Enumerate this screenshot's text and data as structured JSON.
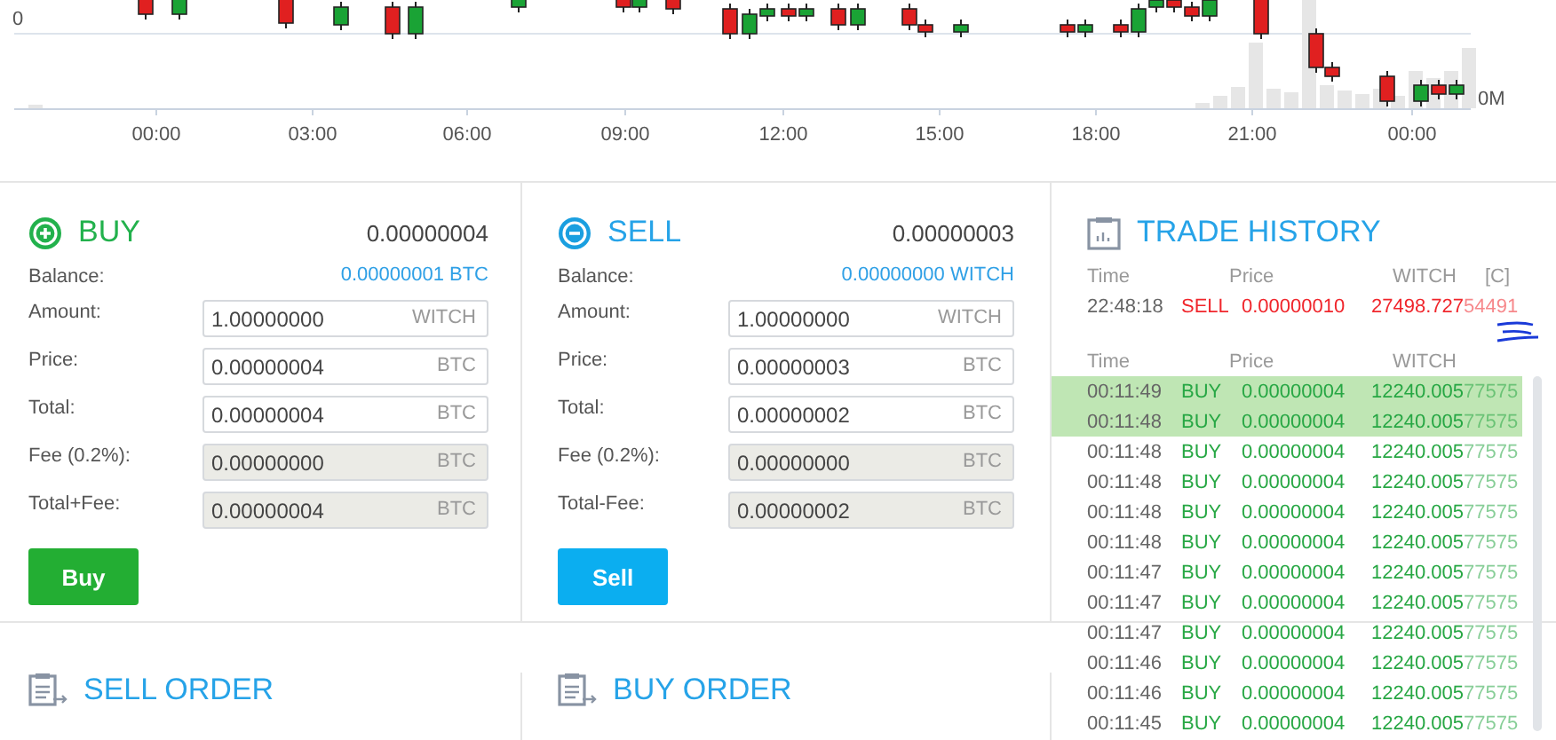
{
  "chart": {
    "y_label": "0",
    "volume_label": "0M",
    "x_ticks": [
      "00:00",
      "03:00",
      "06:00",
      "09:00",
      "12:00",
      "15:00",
      "18:00",
      "21:00",
      "00:00"
    ]
  },
  "buy": {
    "title": "BUY",
    "price": "0.00000004",
    "balance_label": "Balance:",
    "balance": "0.00000001 BTC",
    "fields": [
      {
        "label": "Amount:",
        "value": "1.00000000",
        "unit": "WITCH",
        "disabled": false
      },
      {
        "label": "Price:",
        "value": "0.00000004",
        "unit": "BTC",
        "disabled": false
      },
      {
        "label": "Total:",
        "value": "0.00000004",
        "unit": "BTC",
        "disabled": false
      },
      {
        "label": "Fee (0.2%):",
        "value": "0.00000000",
        "unit": "BTC",
        "disabled": true
      },
      {
        "label": "Total+Fee:",
        "value": "0.00000004",
        "unit": "BTC",
        "disabled": true
      }
    ],
    "button": "Buy"
  },
  "sell": {
    "title": "SELL",
    "price": "0.00000003",
    "balance_label": "Balance:",
    "balance": "0.00000000 WITCH",
    "fields": [
      {
        "label": "Amount:",
        "value": "1.00000000",
        "unit": "WITCH",
        "disabled": false
      },
      {
        "label": "Price:",
        "value": "0.00000003",
        "unit": "BTC",
        "disabled": false
      },
      {
        "label": "Total:",
        "value": "0.00000002",
        "unit": "BTC",
        "disabled": false
      },
      {
        "label": "Fee (0.2%):",
        "value": "0.00000000",
        "unit": "BTC",
        "disabled": true
      },
      {
        "label": "Total-Fee:",
        "value": "0.00000002",
        "unit": "BTC",
        "disabled": true
      }
    ],
    "button": "Sell"
  },
  "trade_history": {
    "title": "TRADE HISTORY",
    "my_columns": [
      "Time",
      "Price",
      "WITCH",
      "[C]"
    ],
    "my_trades": [
      {
        "time": "22:48:18",
        "side": "SELL",
        "price": "0.00000010",
        "amount": "27498.727",
        "amount_tail": "54491"
      }
    ],
    "columns": [
      "Time",
      "Price",
      "WITCH"
    ],
    "trades": [
      {
        "time": "00:11:49",
        "side": "BUY",
        "price": "0.00000004",
        "amount": "12240.005",
        "amount_tail": "77575",
        "highlighted": true
      },
      {
        "time": "00:11:48",
        "side": "BUY",
        "price": "0.00000004",
        "amount": "12240.005",
        "amount_tail": "77575",
        "highlighted": true
      },
      {
        "time": "00:11:48",
        "side": "BUY",
        "price": "0.00000004",
        "amount": "12240.005",
        "amount_tail": "77575",
        "highlighted": false
      },
      {
        "time": "00:11:48",
        "side": "BUY",
        "price": "0.00000004",
        "amount": "12240.005",
        "amount_tail": "77575",
        "highlighted": false
      },
      {
        "time": "00:11:48",
        "side": "BUY",
        "price": "0.00000004",
        "amount": "12240.005",
        "amount_tail": "77575",
        "highlighted": false
      },
      {
        "time": "00:11:48",
        "side": "BUY",
        "price": "0.00000004",
        "amount": "12240.005",
        "amount_tail": "77575",
        "highlighted": false
      },
      {
        "time": "00:11:47",
        "side": "BUY",
        "price": "0.00000004",
        "amount": "12240.005",
        "amount_tail": "77575",
        "highlighted": false
      },
      {
        "time": "00:11:47",
        "side": "BUY",
        "price": "0.00000004",
        "amount": "12240.005",
        "amount_tail": "77575",
        "highlighted": false
      },
      {
        "time": "00:11:47",
        "side": "BUY",
        "price": "0.00000004",
        "amount": "12240.005",
        "amount_tail": "77575",
        "highlighted": false
      },
      {
        "time": "00:11:46",
        "side": "BUY",
        "price": "0.00000004",
        "amount": "12240.005",
        "amount_tail": "77575",
        "highlighted": false
      },
      {
        "time": "00:11:46",
        "side": "BUY",
        "price": "0.00000004",
        "amount": "12240.005",
        "amount_tail": "77575",
        "highlighted": false
      },
      {
        "time": "00:11:45",
        "side": "BUY",
        "price": "0.00000004",
        "amount": "12240.005",
        "amount_tail": "77575",
        "highlighted": false
      }
    ]
  },
  "sell_order": {
    "title": "SELL ORDER"
  },
  "buy_order": {
    "title": "BUY ORDER"
  }
}
